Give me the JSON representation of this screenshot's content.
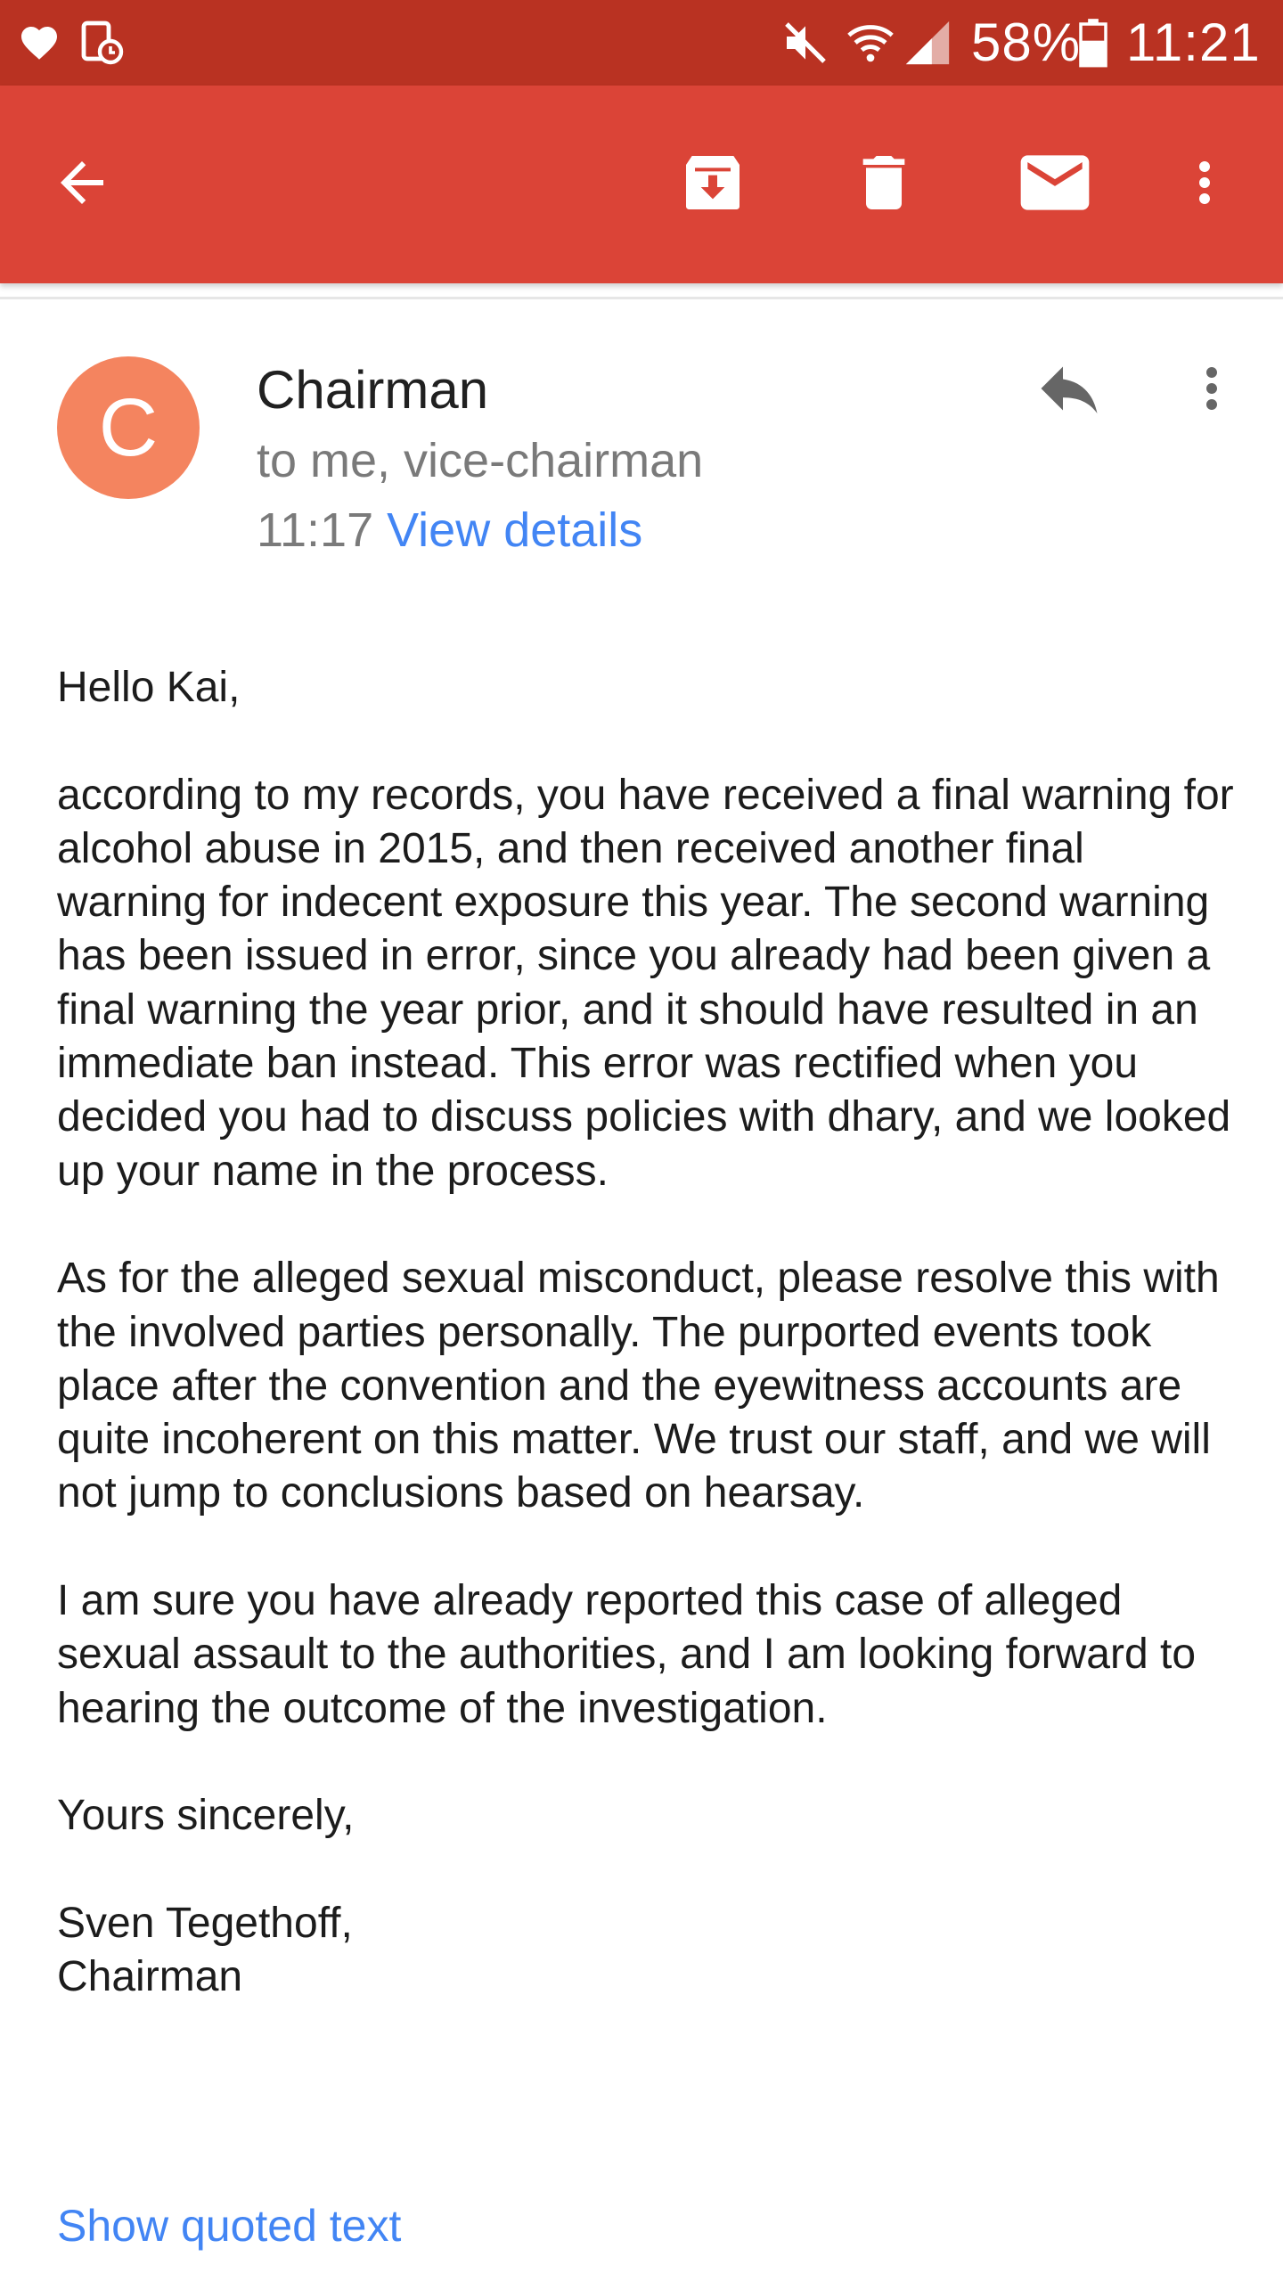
{
  "status_bar": {
    "battery": "58%",
    "time": "11:21",
    "icons": [
      "heart-icon",
      "device-lock-icon",
      "mute-icon",
      "wifi-icon",
      "signal-icon",
      "battery-icon"
    ]
  },
  "toolbar": {
    "icons": [
      "back-arrow-icon",
      "archive-icon",
      "delete-icon",
      "mark-unread-icon",
      "more-vert-icon"
    ]
  },
  "email": {
    "avatar_letter": "C",
    "avatar_color": "#f4845f",
    "sender": "Chairman",
    "recipients": "to me, vice-chairman",
    "time": "11:17",
    "view_details": "View details",
    "greeting": "Hello Kai,",
    "paragraphs": [
      "according to my records, you have received a final warning for alcohol abuse in 2015, and then received another final warning for indecent exposure this year. The second warning has been issued in error, since you already had been given a final warning the year prior, and it should have resulted in an immediate ban instead. This error was rectified when you decided you had to discuss policies with dhary, and we looked up your name in the process.",
      "As for the alleged sexual misconduct, please resolve this with the involved parties personally. The purported events took place after the convention and the eyewitness accounts are quite incoherent on this matter. We trust our staff, and we will not jump to conclusions based on hearsay.",
      "I am sure you have already reported this case of alleged sexual assault to the authorities, and I am looking forward to hearing the outcome of the investigation."
    ],
    "closing": "Yours sincerely,",
    "signature_name": "Sven Tegethoff,",
    "signature_title": "Chairman",
    "show_quoted": "Show quoted text"
  },
  "colors": {
    "status_bar": "#b93222",
    "app_bar": "#db4437",
    "link": "#4285f4"
  }
}
